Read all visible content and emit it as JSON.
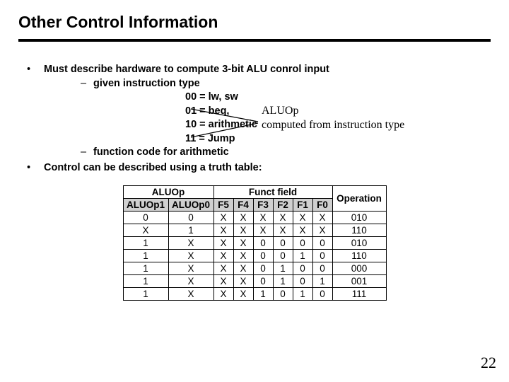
{
  "title": "Other Control Information",
  "bullets": {
    "b1": "Must describe hardware to compute 3-bit ALU conrol input",
    "b2a": "given instruction type",
    "codes": [
      "00 = lw, sw",
      "01 = beq,",
      "10 = arithmetic",
      "11 = Jump"
    ],
    "b2b": "function code for arithmetic",
    "b1b": "Control can be described using a truth table:"
  },
  "annotation": {
    "l1": "ALUOp",
    "l2": "computed from instruction type"
  },
  "chart_data": {
    "type": "table",
    "header_groups": [
      {
        "label": "ALUOp",
        "span": 2
      },
      {
        "label": "Funct field",
        "span": 6
      },
      {
        "label": "Operation",
        "span": 1
      }
    ],
    "columns": [
      "ALUOp1",
      "ALUOp0",
      "F5",
      "F4",
      "F3",
      "F2",
      "F1",
      "F0",
      "Operation"
    ],
    "rows": [
      [
        "0",
        "0",
        "X",
        "X",
        "X",
        "X",
        "X",
        "X",
        "010"
      ],
      [
        "X",
        "1",
        "X",
        "X",
        "X",
        "X",
        "X",
        "X",
        "110"
      ],
      [
        "1",
        "X",
        "X",
        "X",
        "0",
        "0",
        "0",
        "0",
        "010"
      ],
      [
        "1",
        "X",
        "X",
        "X",
        "0",
        "0",
        "1",
        "0",
        "110"
      ],
      [
        "1",
        "X",
        "X",
        "X",
        "0",
        "1",
        "0",
        "0",
        "000"
      ],
      [
        "1",
        "X",
        "X",
        "X",
        "0",
        "1",
        "0",
        "1",
        "001"
      ],
      [
        "1",
        "X",
        "X",
        "X",
        "1",
        "0",
        "1",
        "0",
        "111"
      ]
    ]
  },
  "page_number": "22"
}
